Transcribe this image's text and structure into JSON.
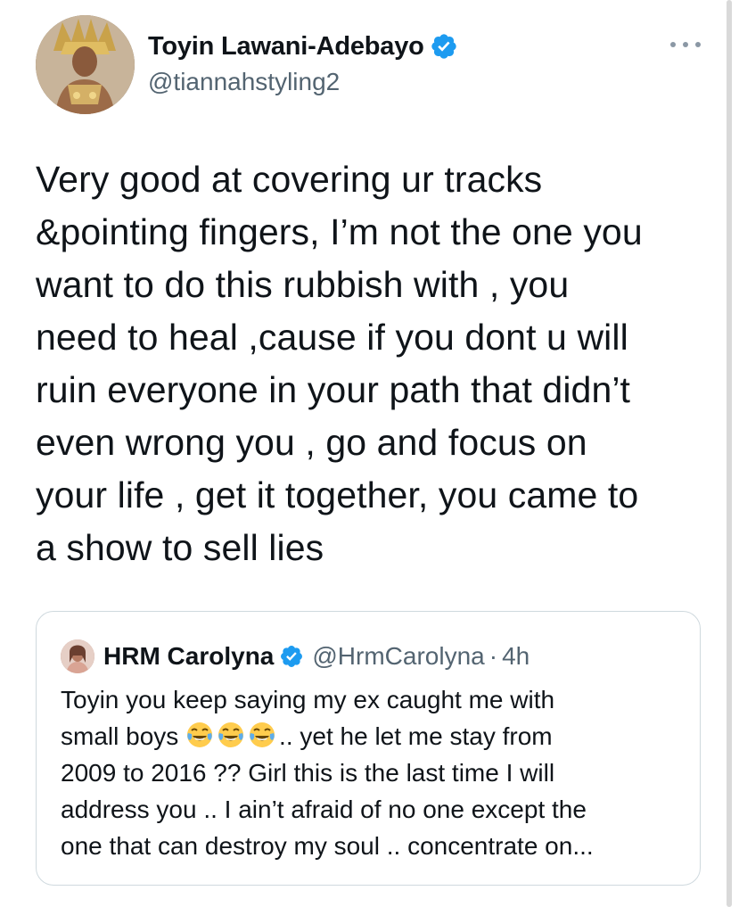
{
  "tweet": {
    "author": {
      "display_name": "Toyin Lawani-Adebayo",
      "handle": "@tiannahstyling2",
      "verified": true,
      "avatar_icon": "avatar-photo"
    },
    "more_icon": "more-horizontal-icon",
    "text_lines": [
      "Very good at covering ur tracks",
      "&pointing fingers, I’m not the one you",
      "want to do this rubbish with , you",
      "need to heal ,cause if you dont u will",
      "ruin everyone in your path that didn’t",
      "even wrong you , go and focus on",
      "your life , get it together, you came to",
      "a show to sell lies"
    ],
    "quoted": {
      "display_name": "HRM Carolyna",
      "handle": "@HrmCarolyna",
      "separator": "·",
      "time": "4h",
      "verified": true,
      "line1": "Toyin you keep saying my ex caught me with",
      "line2_prefix": "small boys ",
      "emoji": [
        "😂",
        "😂",
        "😂"
      ],
      "emoji_icon": "face-with-tears-of-joy-icon",
      "line2_suffix": ".. yet he let me stay from",
      "line3": "2009 to 2016 ?? Girl this is the last time I will",
      "line4": "address you .. I ain’t afraid of no one except the",
      "line5": "one that can destroy my soul .. concentrate on..."
    }
  },
  "colors": {
    "text_primary": "#0f1419",
    "text_secondary": "#536471",
    "verified_blue": "#1d9bf0",
    "border": "#cfd9de"
  }
}
